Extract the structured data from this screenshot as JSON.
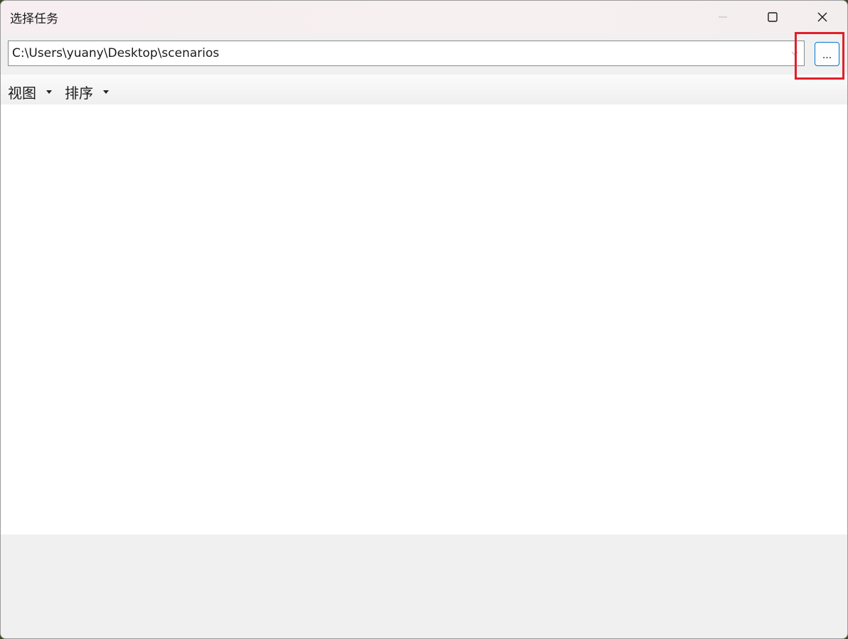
{
  "window": {
    "title": "选择任务"
  },
  "address": {
    "path": "C:\\Users\\yuany\\Desktop\\scenarios",
    "browse_label": "..."
  },
  "toolbar": {
    "view_label": "视图",
    "sort_label": "排序"
  },
  "colors": {
    "accent": "#0078d4",
    "highlight": "#e0202a"
  }
}
